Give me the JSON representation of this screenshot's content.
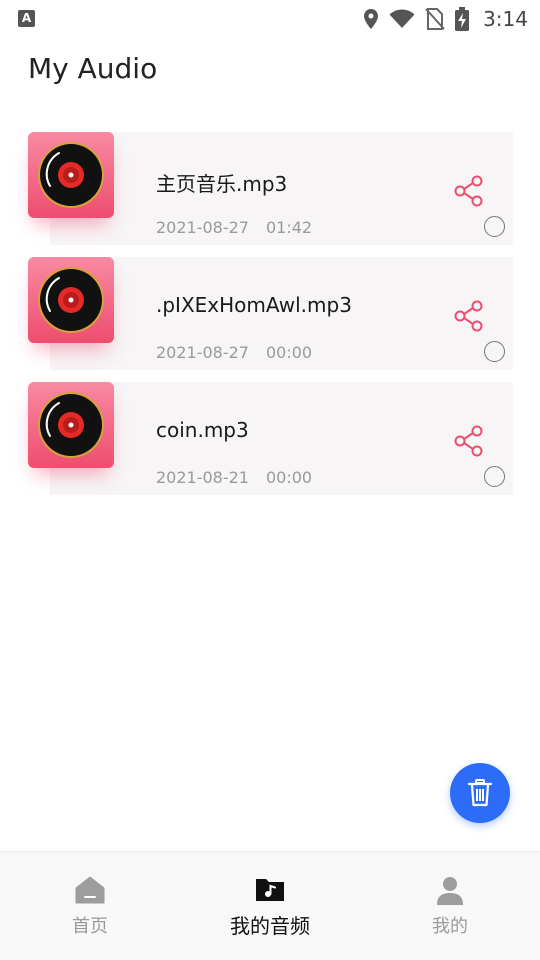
{
  "status_bar": {
    "notification_glyph": "A",
    "time": "3:14",
    "icons": [
      "location-icon",
      "wifi-icon",
      "no-sim-icon",
      "battery-charging-icon"
    ]
  },
  "header": {
    "title": "My Audio"
  },
  "audio_items": [
    {
      "title": "主页音乐.mp3",
      "date": "2021-08-27",
      "duration": "01:42"
    },
    {
      "title": ".pIXExHomAwl.mp3",
      "date": "2021-08-27",
      "duration": "00:00"
    },
    {
      "title": "coin.mp3",
      "date": "2021-08-21",
      "duration": "00:00"
    }
  ],
  "colors": {
    "accent_pink": "#ee4d6f",
    "fab_blue": "#2d6cf6",
    "card_bg": "#f7f5f6"
  },
  "bottom_nav": {
    "items": [
      {
        "label": "首页",
        "icon": "home-icon",
        "active": false
      },
      {
        "label": "我的音频",
        "icon": "music-folder-icon",
        "active": true
      },
      {
        "label": "我的",
        "icon": "person-icon",
        "active": false
      }
    ]
  }
}
